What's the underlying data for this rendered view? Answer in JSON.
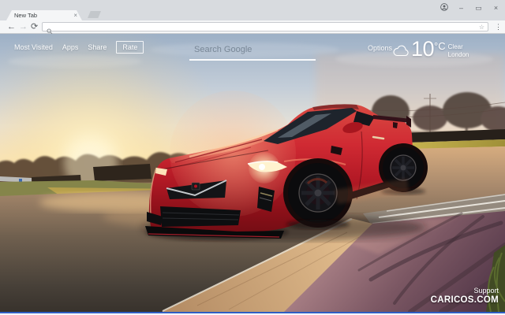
{
  "browser": {
    "tab": {
      "title": "New Tab"
    },
    "glyphs": {
      "tab_close": "×",
      "minimize": "–",
      "maximize": "▭",
      "window_close": "×",
      "back": "←",
      "forward": "→",
      "reload": "⟳",
      "star": "☆",
      "menu": "⋮"
    },
    "address_bar": {
      "value": ""
    }
  },
  "newtab": {
    "nav": {
      "most_visited": "Most Visited",
      "apps": "Apps",
      "share": "Share",
      "rate": "Rate"
    },
    "search": {
      "placeholder": "Search Google"
    },
    "options_label": "Options",
    "weather": {
      "icon": "cloud-icon",
      "temperature": "10",
      "unit": "°C",
      "condition": "Clear",
      "location": "London"
    },
    "footer": {
      "support": "Support",
      "brand": "CARICOS.COM"
    }
  },
  "colors": {
    "frame_bottom_blue": "#2f5ec4",
    "chrome_titlebar": "#d8dbdf",
    "chrome_toolbar": "#f5f6f7",
    "car_red": "#c6202c",
    "sky_top_blue": "#9db0c6",
    "sunset_warm": "#f7d9a4",
    "runoff_purple": "#7b5763"
  }
}
